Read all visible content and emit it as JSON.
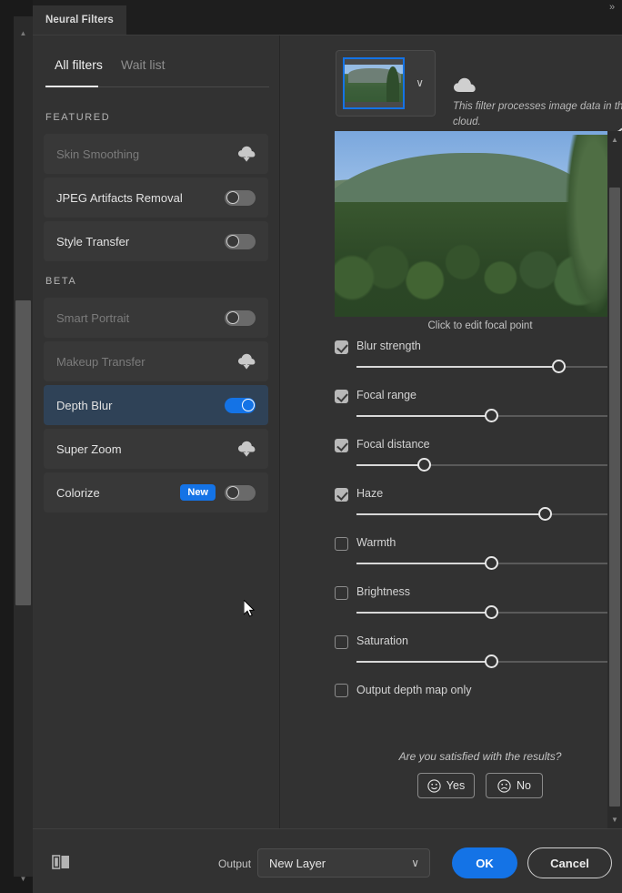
{
  "window": {
    "tab_label": "Neural Filters",
    "expand_icon": "»"
  },
  "panel": {
    "subtabs": [
      {
        "label": "All filters",
        "active": true
      },
      {
        "label": "Wait list",
        "active": false
      }
    ],
    "groups": [
      {
        "label": "FEATURED",
        "filters": [
          {
            "name": "Skin Smoothing",
            "control": "download",
            "enabled": false,
            "selected": false,
            "badge": ""
          },
          {
            "name": "JPEG Artifacts Removal",
            "control": "toggle",
            "on": false,
            "enabled": true,
            "selected": false,
            "badge": ""
          },
          {
            "name": "Style Transfer",
            "control": "toggle",
            "on": false,
            "enabled": true,
            "selected": false,
            "badge": ""
          }
        ]
      },
      {
        "label": "BETA",
        "filters": [
          {
            "name": "Smart Portrait",
            "control": "toggle",
            "on": false,
            "enabled": false,
            "selected": false,
            "badge": ""
          },
          {
            "name": "Makeup Transfer",
            "control": "download",
            "enabled": false,
            "selected": false,
            "badge": ""
          },
          {
            "name": "Depth Blur",
            "control": "toggle",
            "on": true,
            "enabled": true,
            "selected": true,
            "badge": ""
          },
          {
            "name": "Super Zoom",
            "control": "download",
            "enabled": true,
            "selected": false,
            "badge": ""
          },
          {
            "name": "Colorize",
            "control": "toggle",
            "on": false,
            "enabled": true,
            "selected": false,
            "badge": "New"
          }
        ]
      }
    ]
  },
  "detail": {
    "cloud_note": "This filter processes image data in the cloud.",
    "preview_caption": "Click to edit focal point",
    "thumbnail_caret": "∨",
    "reset_icon": "reset-icon",
    "sliders": [
      {
        "label": "Blur strength",
        "value": 75,
        "checked": true,
        "pct": 75
      },
      {
        "label": "Focal range",
        "value": 50,
        "checked": true,
        "pct": 50
      },
      {
        "label": "Focal distance",
        "value": 25,
        "checked": true,
        "pct": 25
      },
      {
        "label": "Haze",
        "value": 70,
        "checked": true,
        "pct": 70
      },
      {
        "label": "Warmth",
        "value": 0,
        "checked": false,
        "pct": 50
      },
      {
        "label": "Brightness",
        "value": 0,
        "checked": false,
        "pct": 50
      },
      {
        "label": "Saturation",
        "value": 0,
        "checked": false,
        "pct": 50
      }
    ],
    "option": {
      "label": "Output depth map only",
      "checked": false
    },
    "feedback": {
      "question": "Are you satisfied with the results?",
      "yes_label": "Yes",
      "no_label": "No"
    }
  },
  "footer": {
    "split_view_icon": "split-view-icon",
    "output_label": "Output",
    "output_value": "New Layer",
    "output_caret": "∨",
    "ok_label": "OK",
    "cancel_label": "Cancel"
  },
  "colors": {
    "accent": "#1473e6",
    "panel_bg": "#323232",
    "row_bg": "#383838",
    "row_selected_bg": "#2f4257",
    "text": "#e2e2e2",
    "text_muted": "#8e8e8e"
  }
}
